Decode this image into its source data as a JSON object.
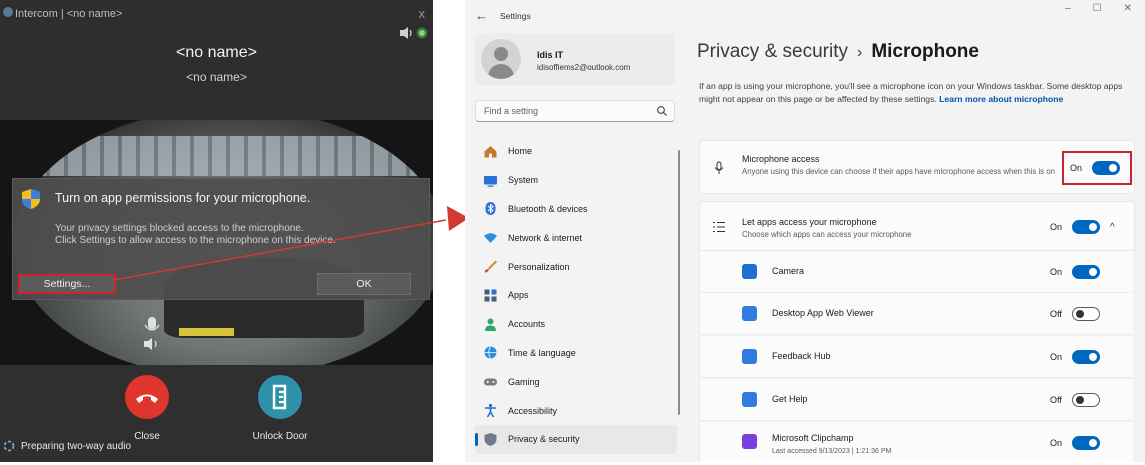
{
  "intercom": {
    "title": "Intercom | <no name>",
    "close_glyph": "x",
    "caller_name": "<no name>",
    "caller_subname": "<no name>",
    "dialog": {
      "title": "Turn on app permissions for your microphone.",
      "line1": "Your privacy settings blocked access to the microphone.",
      "line2": "Click Settings to allow access to the microphone on this device.",
      "settings_button": "Settings...",
      "ok_button": "OK"
    },
    "close_label": "Close",
    "unlock_label": "Unlock Door",
    "status": "Preparing two-way audio",
    "colors": {
      "close": "#e0352d",
      "unlock": "#2f92a8",
      "highlight": "#d0242a"
    },
    "icons": [
      "speaker-icon",
      "shield-icon",
      "phone-hangup-icon",
      "door-unlock-icon",
      "loading-icon"
    ]
  },
  "settings": {
    "app_title": "Settings",
    "profile": {
      "name": "Idis IT",
      "email": "idisoffiems2@outlook.com"
    },
    "search_placeholder": "Find a setting",
    "nav": [
      {
        "label": "Home",
        "icon": "home-icon"
      },
      {
        "label": "System",
        "icon": "monitor-icon"
      },
      {
        "label": "Bluetooth & devices",
        "icon": "bluetooth-icon"
      },
      {
        "label": "Network & internet",
        "icon": "wifi-icon"
      },
      {
        "label": "Personalization",
        "icon": "brush-icon"
      },
      {
        "label": "Apps",
        "icon": "apps-icon"
      },
      {
        "label": "Accounts",
        "icon": "person-icon"
      },
      {
        "label": "Time & language",
        "icon": "globe-icon"
      },
      {
        "label": "Gaming",
        "icon": "gamepad-icon"
      },
      {
        "label": "Accessibility",
        "icon": "accessibility-icon"
      },
      {
        "label": "Privacy & security",
        "icon": "shield-icon",
        "active": true
      }
    ],
    "breadcrumb": {
      "parent": "Privacy & security",
      "separator": "›",
      "current": "Microphone"
    },
    "description": "If an app is using your microphone, you'll see a microphone icon on your Windows taskbar. Some desktop apps might not appear on this page or be affected by these settings.",
    "learn_more": "Learn more about microphone",
    "mic_access": {
      "title": "Microphone access",
      "subtitle": "Anyone using this device can choose if their apps have microphone access when this is on",
      "state": "On"
    },
    "let_apps": {
      "title": "Let apps access your microphone",
      "subtitle": "Choose which apps can access your microphone",
      "state": "On",
      "chevron": "^"
    },
    "apps": [
      {
        "name": "Camera",
        "sub": "",
        "state": "On",
        "color": "#1f6fd1"
      },
      {
        "name": "Desktop App Web Viewer",
        "sub": "",
        "state": "Off",
        "color": "#2f7be0"
      },
      {
        "name": "Feedback Hub",
        "sub": "",
        "state": "On",
        "color": "#2f7be0"
      },
      {
        "name": "Get Help",
        "sub": "",
        "state": "Off",
        "color": "#2f7be0"
      },
      {
        "name": "Microsoft Clipchamp",
        "sub": "Last accessed 9/13/2023 | 1:21:36 PM",
        "state": "On",
        "color": "#7b3fe0"
      }
    ],
    "win_controls": [
      "–",
      "☐",
      "✕"
    ],
    "accent": "#0067c0",
    "highlight": "#c8232c"
  }
}
